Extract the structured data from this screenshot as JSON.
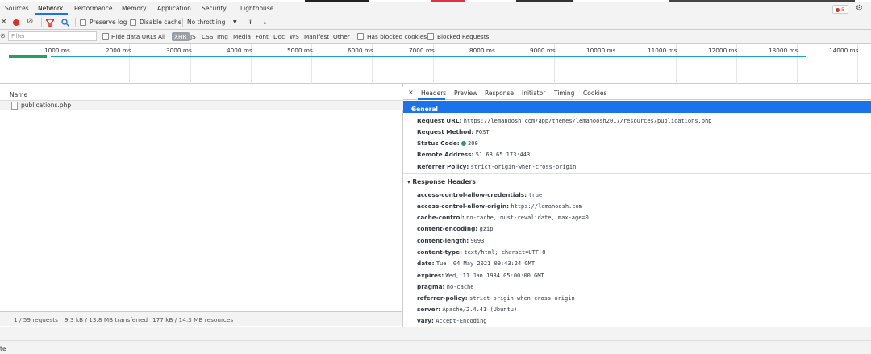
{
  "tabs": [
    "Sources",
    "Network",
    "Performance",
    "Memory",
    "Application",
    "Security",
    "Lighthouse"
  ],
  "error_count": "5",
  "toolbar": {
    "preserve_log": "Preserve log",
    "disable_cache": "Disable cache",
    "throttling": "No throttling"
  },
  "filter": {
    "placeholder": "Filter",
    "hide_data_urls": "Hide data URLs",
    "types": [
      "All",
      "XHR",
      "JS",
      "CSS",
      "Img",
      "Media",
      "Font",
      "Doc",
      "WS",
      "Manifest",
      "Other"
    ],
    "has_blocked_cookies": "Has blocked cookies",
    "blocked_requests": "Blocked Requests"
  },
  "timeline_ticks": [
    "1000 ms",
    "2000 ms",
    "3000 ms",
    "4000 ms",
    "5000 ms",
    "6000 ms",
    "7000 ms",
    "8000 ms",
    "9000 ms",
    "10000 ms",
    "11000 ms",
    "12000 ms",
    "13000 ms",
    "14000 ms"
  ],
  "requests": {
    "column_name": "Name",
    "rows": [
      "publications.php"
    ]
  },
  "summary": {
    "requests": "1 / 59 requests",
    "transferred": "9.3 kB / 13.8 MB transferred",
    "resources": "177 kB / 14.3 MB resources"
  },
  "detail_tabs": [
    "Headers",
    "Preview",
    "Response",
    "Initiator",
    "Timing",
    "Cookies"
  ],
  "general": {
    "title": "General",
    "rows": [
      {
        "k": "Request URL:",
        "v": "https://lemanoosh.com/app/themes/lemanoosh2017/resources/publications.php"
      },
      {
        "k": "Request Method:",
        "v": "POST"
      },
      {
        "k": "Status Code:",
        "v": "200"
      },
      {
        "k": "Remote Address:",
        "v": "51.68.65.173:443"
      },
      {
        "k": "Referrer Policy:",
        "v": "strict-origin-when-cross-origin"
      }
    ]
  },
  "response_headers": {
    "title": "Response Headers",
    "rows": [
      {
        "k": "access-control-allow-credentials:",
        "v": "true"
      },
      {
        "k": "access-control-allow-origin:",
        "v": "https://lemanoosh.com"
      },
      {
        "k": "cache-control:",
        "v": "no-cache, must-revalidate, max-age=0"
      },
      {
        "k": "content-encoding:",
        "v": "gzip"
      },
      {
        "k": "content-length:",
        "v": "9093"
      },
      {
        "k": "content-type:",
        "v": "text/html; charset=UTF-8"
      },
      {
        "k": "date:",
        "v": "Tue, 04 May 2021 09:43:24 GMT"
      },
      {
        "k": "expires:",
        "v": "Wed, 11 Jan 1984 05:00:00 GMT"
      },
      {
        "k": "pragma:",
        "v": "no-cache"
      },
      {
        "k": "referrer-policy:",
        "v": "strict-origin-when-cross-origin"
      },
      {
        "k": "server:",
        "v": "Apache/2.4.41 (Ubuntu)"
      },
      {
        "k": "vary:",
        "v": "Accept-Encoding"
      }
    ]
  },
  "bottom": "te"
}
